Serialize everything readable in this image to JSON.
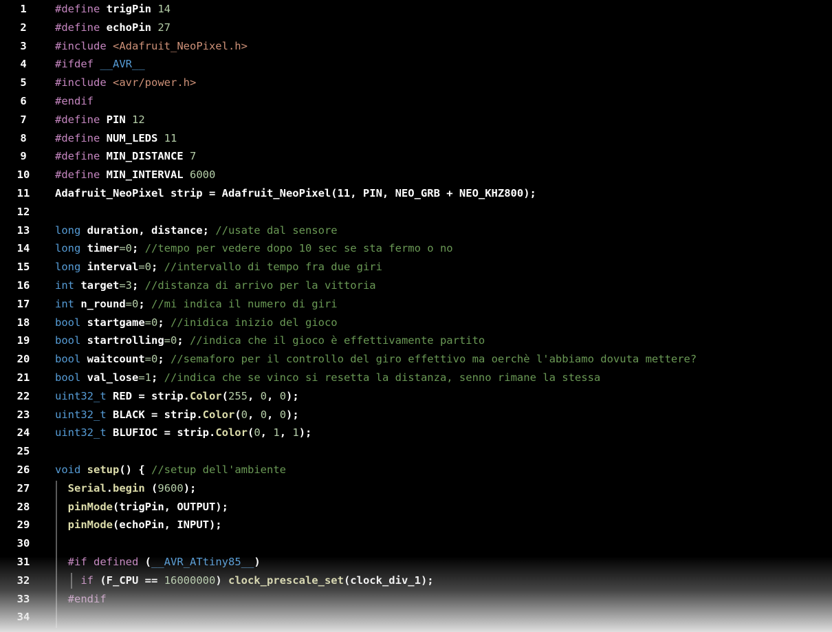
{
  "editor": {
    "language": "Arduino C++",
    "colors": {
      "background": "#000000",
      "preprocessor": "#c586c0",
      "type": "#569cd6",
      "number": "#b5cea8",
      "string": "#ce9178",
      "comment": "#6a9955",
      "function": "#dcdcaa",
      "text": "#ffffff"
    },
    "lines": [
      {
        "n": "1",
        "tokens": [
          [
            "pre",
            "#define "
          ],
          [
            "def",
            "trigPin "
          ],
          [
            "num",
            "14"
          ]
        ]
      },
      {
        "n": "2",
        "tokens": [
          [
            "pre",
            "#define "
          ],
          [
            "def",
            "echoPin "
          ],
          [
            "num",
            "27"
          ]
        ]
      },
      {
        "n": "3",
        "tokens": [
          [
            "pre",
            "#include "
          ],
          [
            "str",
            "<Adafruit_NeoPixel.h>"
          ]
        ]
      },
      {
        "n": "4",
        "tokens": [
          [
            "pre",
            "#ifdef "
          ],
          [
            "mac",
            "__AVR__"
          ]
        ]
      },
      {
        "n": "5",
        "tokens": [
          [
            "pre",
            "#include "
          ],
          [
            "str",
            "<avr/power.h>"
          ]
        ]
      },
      {
        "n": "6",
        "tokens": [
          [
            "pre",
            "#endif"
          ]
        ]
      },
      {
        "n": "7",
        "tokens": [
          [
            "pre",
            "#define "
          ],
          [
            "def",
            "PIN "
          ],
          [
            "num",
            "12"
          ]
        ]
      },
      {
        "n": "8",
        "tokens": [
          [
            "pre",
            "#define "
          ],
          [
            "def",
            "NUM_LEDS "
          ],
          [
            "num",
            "11"
          ]
        ]
      },
      {
        "n": "9",
        "tokens": [
          [
            "pre",
            "#define "
          ],
          [
            "def",
            "MIN_DISTANCE "
          ],
          [
            "num",
            "7"
          ]
        ]
      },
      {
        "n": "10",
        "tokens": [
          [
            "pre",
            "#define "
          ],
          [
            "def",
            "MIN_INTERVAL "
          ],
          [
            "num",
            "6000"
          ]
        ]
      },
      {
        "n": "11",
        "tokens": [
          [
            "def",
            "Adafruit_NeoPixel strip = Adafruit_NeoPixel(11, PIN, NEO_GRB + NEO_KHZ800);"
          ]
        ]
      },
      {
        "n": "12",
        "tokens": []
      },
      {
        "n": "13",
        "tokens": [
          [
            "type",
            "long "
          ],
          [
            "def",
            "duration, distance; "
          ],
          [
            "com",
            "//usate dal sensore"
          ]
        ]
      },
      {
        "n": "14",
        "tokens": [
          [
            "type",
            "long "
          ],
          [
            "def",
            "timer"
          ],
          [
            "num",
            "=0"
          ],
          [
            "def",
            "; "
          ],
          [
            "com",
            "//tempo per vedere dopo 10 sec se sta fermo o no"
          ]
        ]
      },
      {
        "n": "15",
        "tokens": [
          [
            "type",
            "long "
          ],
          [
            "def",
            "interval"
          ],
          [
            "num",
            "=0"
          ],
          [
            "def",
            "; "
          ],
          [
            "com",
            "//intervallo di tempo fra due giri"
          ]
        ]
      },
      {
        "n": "16",
        "tokens": [
          [
            "type",
            "int "
          ],
          [
            "def",
            "target"
          ],
          [
            "num",
            "=3"
          ],
          [
            "def",
            "; "
          ],
          [
            "com",
            "//distanza di arrivo per la vittoria"
          ]
        ]
      },
      {
        "n": "17",
        "tokens": [
          [
            "type",
            "int "
          ],
          [
            "def",
            "n_round"
          ],
          [
            "num",
            "=0"
          ],
          [
            "def",
            "; "
          ],
          [
            "com",
            "//mi indica il numero di giri"
          ]
        ]
      },
      {
        "n": "18",
        "tokens": [
          [
            "type",
            "bool "
          ],
          [
            "def",
            "startgame"
          ],
          [
            "num",
            "=0"
          ],
          [
            "def",
            "; "
          ],
          [
            "com",
            "//inidica inizio del gioco"
          ]
        ]
      },
      {
        "n": "19",
        "tokens": [
          [
            "type",
            "bool "
          ],
          [
            "def",
            "startrolling"
          ],
          [
            "num",
            "=0"
          ],
          [
            "def",
            "; "
          ],
          [
            "com",
            "//indica che il gioco è effettivamente partito"
          ]
        ]
      },
      {
        "n": "20",
        "tokens": [
          [
            "type",
            "bool "
          ],
          [
            "def",
            "waitcount"
          ],
          [
            "num",
            "=0"
          ],
          [
            "def",
            "; "
          ],
          [
            "com",
            "//semaforo per il controllo del giro effettivo ma oerchè l'abbiamo dovuta mettere?"
          ]
        ]
      },
      {
        "n": "21",
        "tokens": [
          [
            "type",
            "bool "
          ],
          [
            "def",
            "val_lose"
          ],
          [
            "num",
            "=1"
          ],
          [
            "def",
            "; "
          ],
          [
            "com",
            "//indica che se vinco si resetta la distanza, senno rimane la stessa"
          ]
        ]
      },
      {
        "n": "22",
        "tokens": [
          [
            "type",
            "uint32_t "
          ],
          [
            "def",
            "RED = strip."
          ],
          [
            "fn",
            "Color"
          ],
          [
            "def",
            "("
          ],
          [
            "num",
            "255"
          ],
          [
            "def",
            ", "
          ],
          [
            "num",
            "0"
          ],
          [
            "def",
            ", "
          ],
          [
            "num",
            "0"
          ],
          [
            "def",
            ");"
          ]
        ]
      },
      {
        "n": "23",
        "tokens": [
          [
            "type",
            "uint32_t "
          ],
          [
            "def",
            "BLACK = strip."
          ],
          [
            "fn",
            "Color"
          ],
          [
            "def",
            "("
          ],
          [
            "num",
            "0"
          ],
          [
            "def",
            ", "
          ],
          [
            "num",
            "0"
          ],
          [
            "def",
            ", "
          ],
          [
            "num",
            "0"
          ],
          [
            "def",
            ");"
          ]
        ]
      },
      {
        "n": "24",
        "tokens": [
          [
            "type",
            "uint32_t "
          ],
          [
            "def",
            "BLUFIOC = strip."
          ],
          [
            "fn",
            "Color"
          ],
          [
            "def",
            "("
          ],
          [
            "num",
            "0"
          ],
          [
            "def",
            ", "
          ],
          [
            "num",
            "1"
          ],
          [
            "def",
            ", "
          ],
          [
            "num",
            "1"
          ],
          [
            "def",
            ");"
          ]
        ]
      },
      {
        "n": "25",
        "tokens": []
      },
      {
        "n": "26",
        "tokens": [
          [
            "type",
            "void "
          ],
          [
            "fn",
            "setup"
          ],
          [
            "def",
            "() { "
          ],
          [
            "com",
            "//setup dell'ambiente"
          ]
        ]
      },
      {
        "n": "27",
        "tokens": [
          [
            "def",
            "  "
          ],
          [
            "fn",
            "Serial"
          ],
          [
            "def",
            "."
          ],
          [
            "fn",
            "begin"
          ],
          [
            "def",
            " ("
          ],
          [
            "num",
            "9600"
          ],
          [
            "def",
            ");"
          ]
        ]
      },
      {
        "n": "28",
        "tokens": [
          [
            "def",
            "  "
          ],
          [
            "fn",
            "pinMode"
          ],
          [
            "def",
            "(trigPin, OUTPUT);"
          ]
        ]
      },
      {
        "n": "29",
        "tokens": [
          [
            "def",
            "  "
          ],
          [
            "fn",
            "pinMode"
          ],
          [
            "def",
            "(echoPin, INPUT);"
          ]
        ]
      },
      {
        "n": "30",
        "tokens": []
      },
      {
        "n": "31",
        "tokens": [
          [
            "def",
            "  "
          ],
          [
            "pre",
            "#if "
          ],
          [
            "pre",
            "defined "
          ],
          [
            "def",
            "("
          ],
          [
            "mac",
            "__AVR_ATtiny85__"
          ],
          [
            "def",
            ")"
          ]
        ]
      },
      {
        "n": "32",
        "tokens": [
          [
            "def",
            "    "
          ],
          [
            "pre",
            "if "
          ],
          [
            "def",
            "(F_CPU == "
          ],
          [
            "num",
            "16000000"
          ],
          [
            "def",
            ") "
          ],
          [
            "fn",
            "clock_prescale_set"
          ],
          [
            "def",
            "(clock_div_1);"
          ]
        ]
      },
      {
        "n": "33",
        "tokens": [
          [
            "def",
            "  "
          ],
          [
            "pre",
            "#endif"
          ]
        ]
      },
      {
        "n": "34",
        "tokens": []
      }
    ]
  }
}
